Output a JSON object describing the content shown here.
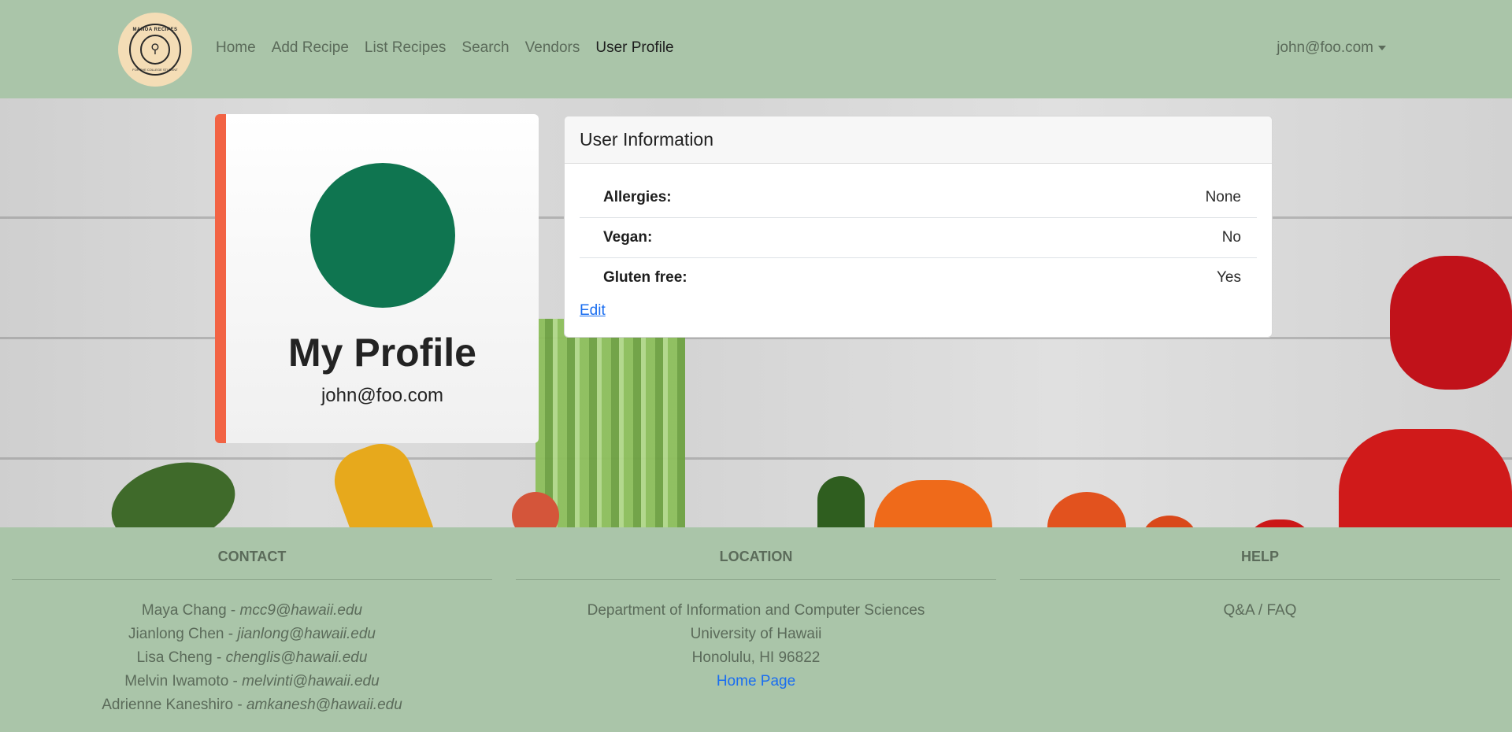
{
  "navbar": {
    "logo": {
      "title": "MANOA RECIPES",
      "subtitle": "FOR THE COLLEGE STUDENT"
    },
    "links": [
      {
        "label": "Home"
      },
      {
        "label": "Add Recipe"
      },
      {
        "label": "List Recipes"
      },
      {
        "label": "Search"
      },
      {
        "label": "Vendors"
      },
      {
        "label": "User Profile",
        "active": true
      }
    ],
    "user_menu": "john@foo.com"
  },
  "profile": {
    "title": "My Profile",
    "email": "john@foo.com",
    "avatar_color": "#0f7550",
    "accent_color": "#f26344"
  },
  "user_info": {
    "header": "User Information",
    "rows": [
      {
        "label": "Allergies:",
        "value": "None"
      },
      {
        "label": "Vegan:",
        "value": "No"
      },
      {
        "label": "Gluten free:",
        "value": "Yes"
      }
    ],
    "edit_label": "Edit"
  },
  "footer": {
    "contact": {
      "heading": "CONTACT",
      "people": [
        {
          "name": "Maya Chang - ",
          "email": "mcc9@hawaii.edu"
        },
        {
          "name": "Jianlong Chen - ",
          "email": "jianlong@hawaii.edu"
        },
        {
          "name": "Lisa Cheng - ",
          "email": "chenglis@hawaii.edu"
        },
        {
          "name": "Melvin Iwamoto - ",
          "email": "melvinti@hawaii.edu"
        },
        {
          "name": "Adrienne Kaneshiro - ",
          "email": "amkanesh@hawaii.edu"
        }
      ]
    },
    "location": {
      "heading": "LOCATION",
      "lines": [
        "Department of Information and Computer Sciences",
        "University of Hawaii",
        "Honolulu, HI 96822"
      ],
      "link": "Home Page"
    },
    "help": {
      "heading": "HELP",
      "link": "Q&A / FAQ"
    }
  },
  "colors": {
    "nav_bg": "#aac5a9",
    "link_blue": "#1a6ef0"
  }
}
